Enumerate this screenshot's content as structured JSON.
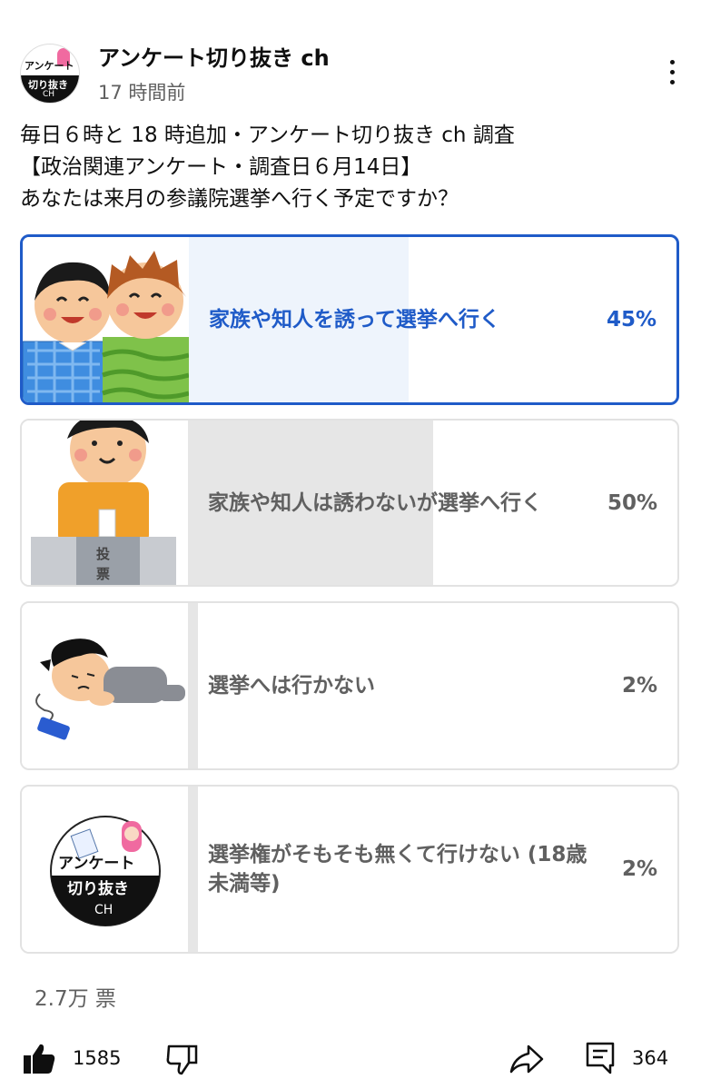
{
  "post": {
    "channel_name": "アンケート切り抜き ch",
    "time": "17 時間前",
    "avatar_text": [
      "アンケート",
      "切り抜き",
      "CH"
    ],
    "text_lines": [
      "毎日６時と 18 時追加・アンケート切り抜き ch 調査",
      "【政治関連アンケート・調査日６月14日】",
      "あなたは来月の参議院選挙へ行く予定ですか？"
    ]
  },
  "poll": {
    "options": [
      {
        "label": "家族や知人を誘って選挙へ行く",
        "percent": "45%",
        "value": 45,
        "selected": true,
        "image": "two-friends-illustration"
      },
      {
        "label": "家族や知人は誘わないが選挙へ行く",
        "percent": "50%",
        "value": 50,
        "selected": false,
        "image": "voting-box-illustration"
      },
      {
        "label": "選挙へは行かない",
        "percent": "2%",
        "value": 2,
        "selected": false,
        "image": "lying-person-illustration"
      },
      {
        "label": "選挙権がそもそも無くて行けない (18歳未満等)",
        "percent": "2%",
        "value": 2,
        "selected": false,
        "image": "channel-logo-illustration"
      }
    ],
    "logo_text": [
      "アンケート",
      "切り抜き",
      "CH"
    ],
    "ballot_box_text": [
      "投",
      "票"
    ],
    "votes": "2.7万 票"
  },
  "actions": {
    "like_count": "1585",
    "comment_count": "364",
    "icons": [
      "like-icon",
      "dislike-icon",
      "share-icon",
      "comment-icon",
      "more-vert-icon"
    ]
  },
  "colors": {
    "accent": "#1f5bc8",
    "selected_fill": "#eef4fc",
    "fill": "#e6e6e6",
    "secondary_text": "#606060"
  }
}
